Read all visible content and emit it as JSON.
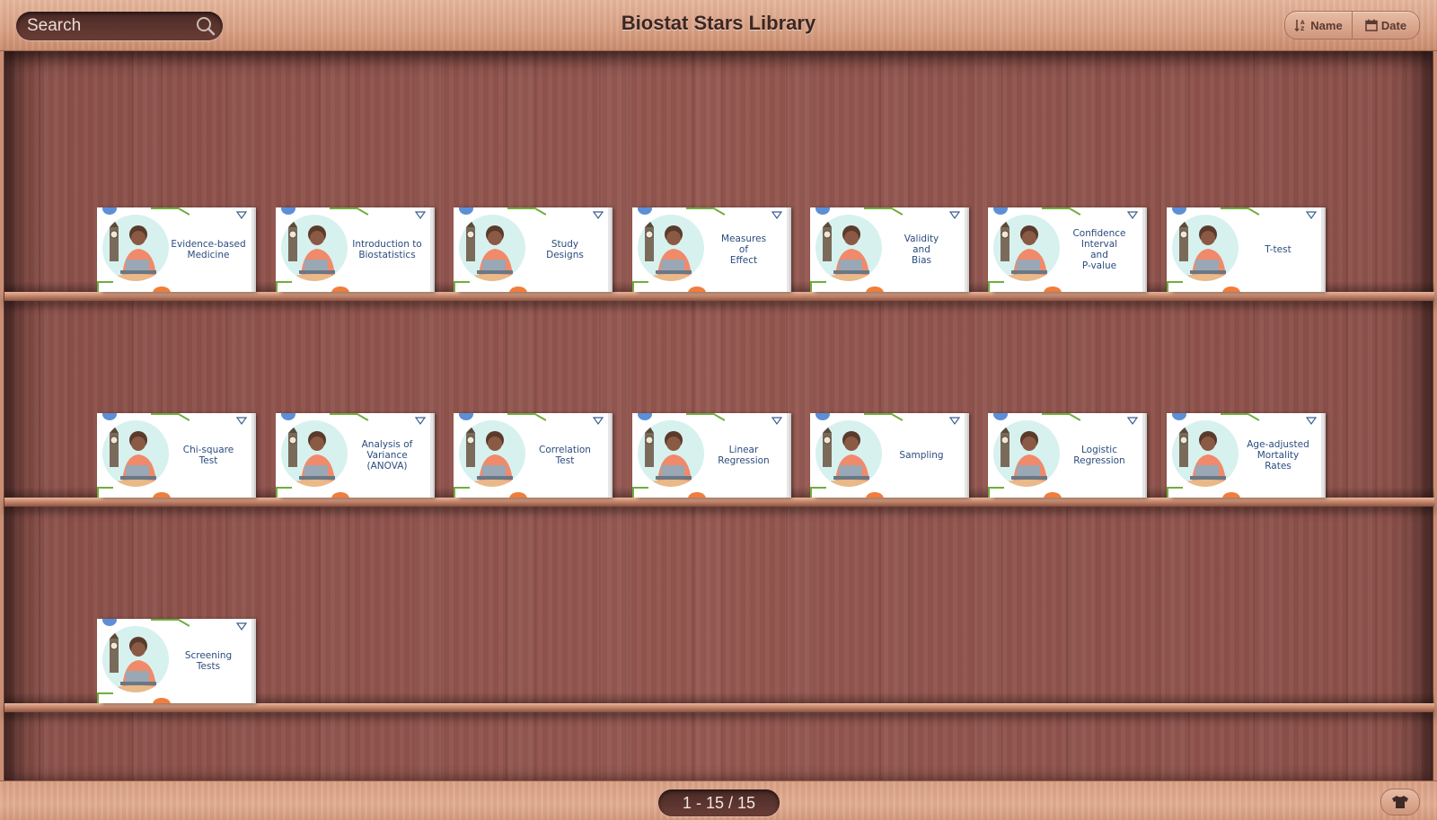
{
  "header": {
    "title": "Biostat Stars Library",
    "search_placeholder": "Search",
    "sort_name_label": "Name",
    "sort_date_label": "Date"
  },
  "books": [
    {
      "title": "Evidence-based\nMedicine"
    },
    {
      "title": "Introduction to\nBiostatistics"
    },
    {
      "title": "Study\nDesigns"
    },
    {
      "title": "Measures\nof\nEffect"
    },
    {
      "title": "Validity\nand\nBias"
    },
    {
      "title": "Confidence Interval\nand\nP-value"
    },
    {
      "title": "T-test"
    },
    {
      "title": "Chi-square\nTest"
    },
    {
      "title": "Analysis of\nVariance\n(ANOVA)"
    },
    {
      "title": "Correlation\nTest"
    },
    {
      "title": "Linear\nRegression"
    },
    {
      "title": "Sampling"
    },
    {
      "title": "Logistic\nRegression"
    },
    {
      "title": "Age-adjusted\nMortality\nRates"
    },
    {
      "title": "Screening\nTests"
    }
  ],
  "footer": {
    "pagination": "1 - 15 / 15"
  },
  "colors": {
    "accent_blue": "#5c8fd6",
    "accent_orange": "#f07d3c",
    "accent_green": "#6fae3f",
    "book_text": "#2b4c7e"
  },
  "icons": {
    "search": "search-icon",
    "sort_name": "sort-alpha-icon",
    "sort_date": "calendar-icon",
    "theme": "shirt-icon"
  }
}
